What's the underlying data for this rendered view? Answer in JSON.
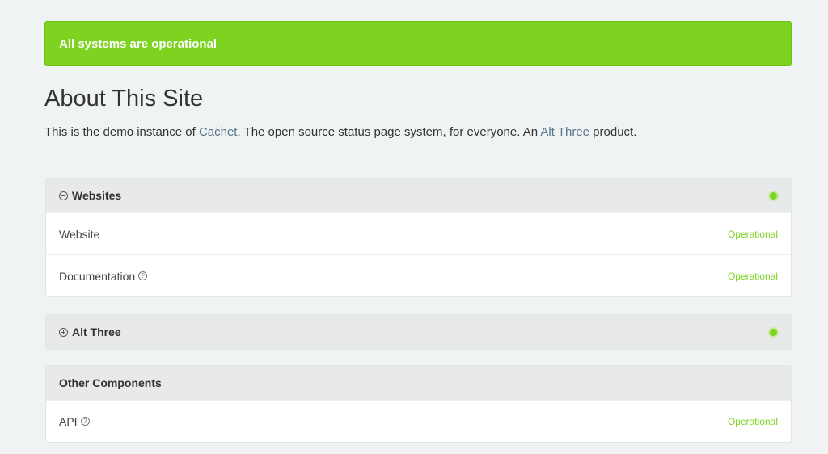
{
  "banner": {
    "text": "All systems are operational",
    "color": "#7ed321"
  },
  "about": {
    "title": "About This Site",
    "text_before": "This is the demo instance of ",
    "link1": "Cachet",
    "text_middle": ". The open source status page system, for everyone. An ",
    "link2": "Alt Three",
    "text_after": " product."
  },
  "groups": [
    {
      "name": "Websites",
      "toggle_icon": "minus-circle-icon",
      "components": [
        {
          "name": "Website",
          "status": "Operational",
          "has_help": false
        },
        {
          "name": "Documentation",
          "status": "Operational",
          "has_help": true,
          "help_icon": "question-circle-icon"
        }
      ]
    },
    {
      "name": "Alt Three",
      "toggle_icon": "plus-circle-icon",
      "components": []
    },
    {
      "name": "Other Components",
      "components": [
        {
          "name": "API",
          "status": "Operational",
          "has_help": true,
          "help_icon": "question-circle-icon"
        }
      ]
    }
  ],
  "colors": {
    "operational": "#7ed321",
    "link": "#58748c"
  }
}
